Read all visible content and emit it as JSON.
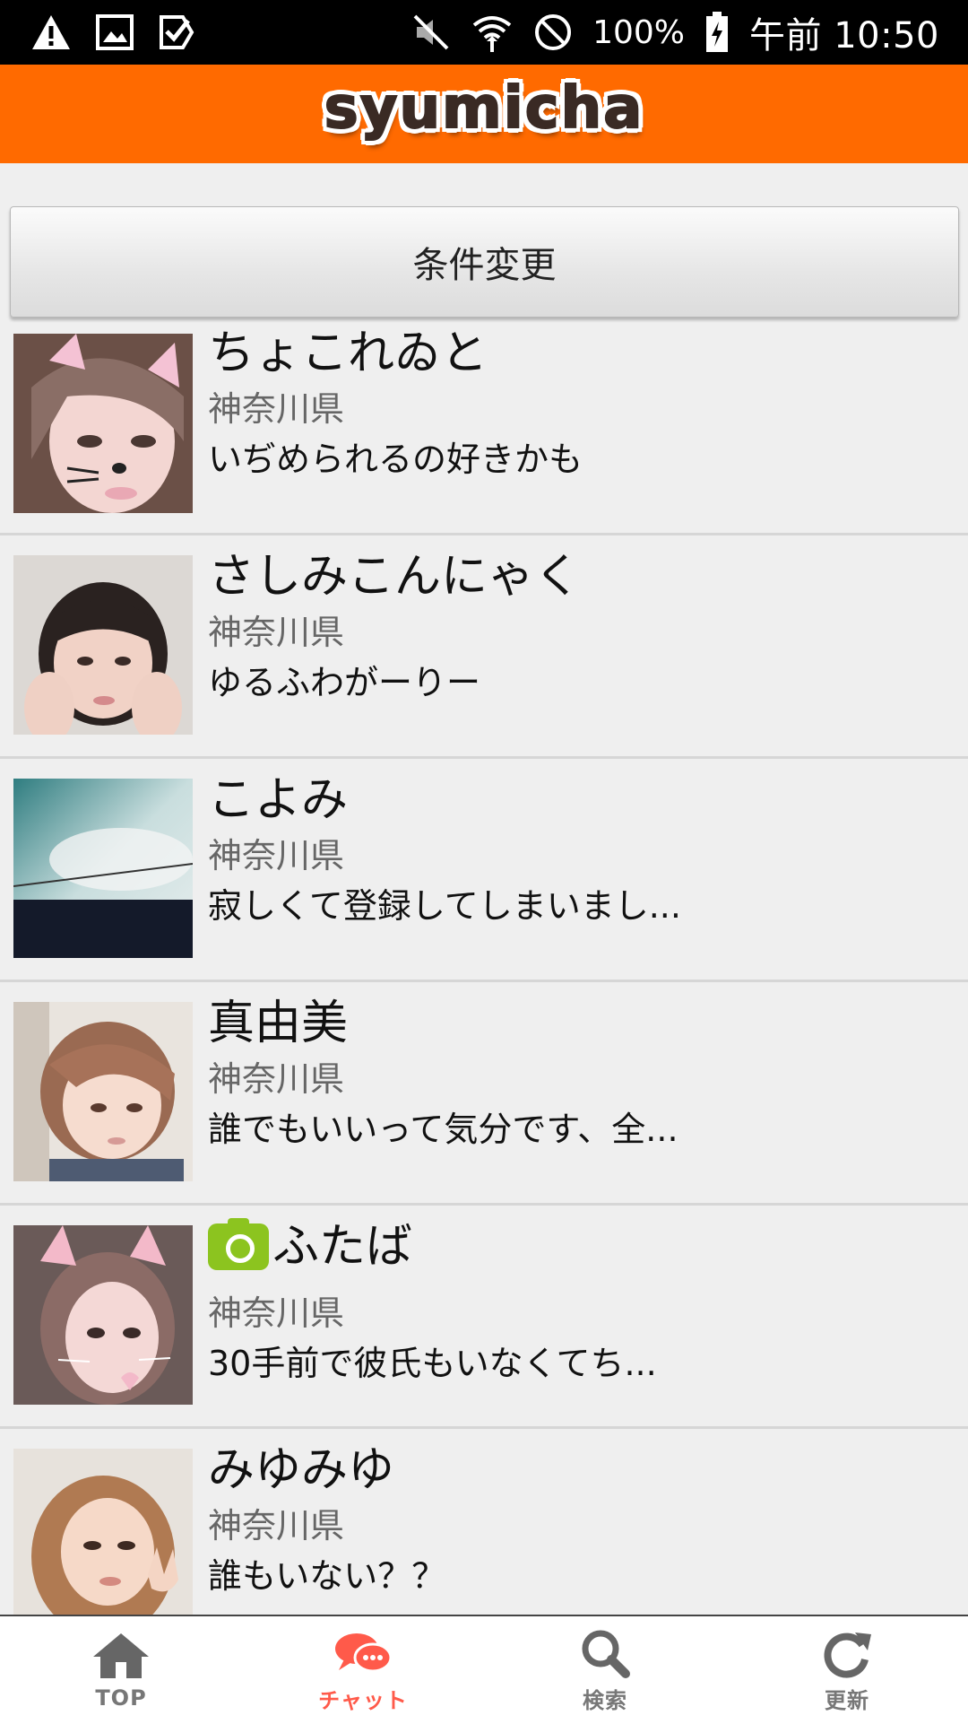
{
  "status_bar": {
    "battery": "100%",
    "time": "午前 10:50"
  },
  "app": {
    "logo_text": "syumicha"
  },
  "filter_button_label": "条件変更",
  "users": [
    {
      "name": "ちょこれゐと",
      "prefecture": "神奈川県",
      "message": "いぢめられるの好きかも",
      "camera": false
    },
    {
      "name": "さしみこんにゃく",
      "prefecture": "神奈川県",
      "message": "ゆるふわがーりー",
      "camera": false
    },
    {
      "name": "こよみ",
      "prefecture": "神奈川県",
      "message": "寂しくて登録してしまいまし...",
      "camera": false
    },
    {
      "name": "真由美",
      "prefecture": "神奈川県",
      "message": "誰でもいいって気分です、全...",
      "camera": false
    },
    {
      "name": "ふたば",
      "prefecture": "神奈川県",
      "message": "30手前で彼氏もいなくてち...",
      "camera": true
    },
    {
      "name": "みゆみゆ",
      "prefecture": "神奈川県",
      "message": "誰もいない？？",
      "camera": false
    }
  ],
  "bottom_nav": [
    {
      "label": "TOP",
      "icon": "home-icon",
      "active": false
    },
    {
      "label": "チャット",
      "icon": "chat-icon",
      "active": true
    },
    {
      "label": "検索",
      "icon": "search-icon",
      "active": false
    },
    {
      "label": "更新",
      "icon": "refresh-icon",
      "active": false
    }
  ],
  "colors": {
    "header": "#ff6a00",
    "active_nav": "#ff5a4a",
    "camera_badge": "#8cc41f"
  }
}
